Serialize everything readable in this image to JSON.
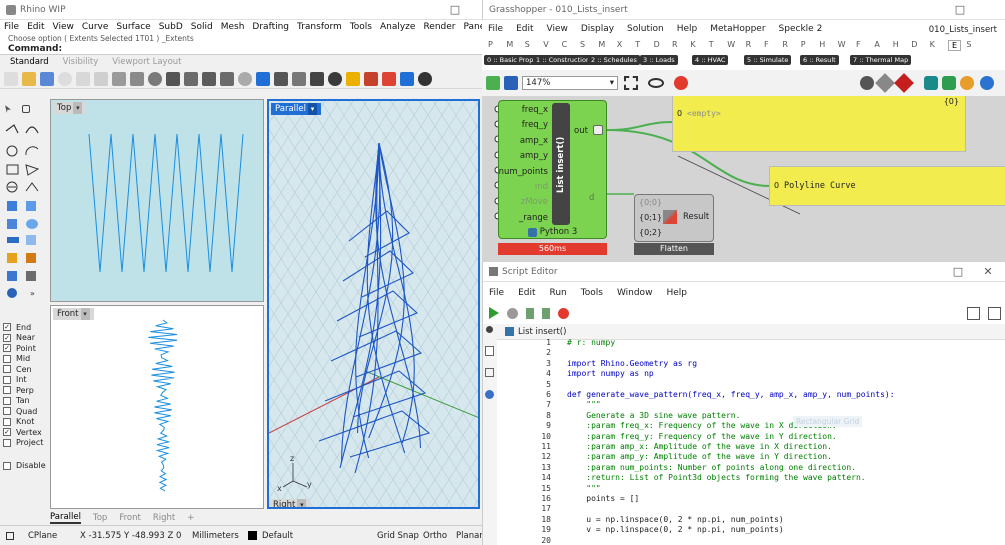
{
  "rhino": {
    "title": "Rhino WIP",
    "menu": [
      "File",
      "Edit",
      "View",
      "Curve",
      "Surface",
      "SubD",
      "Solid",
      "Mesh",
      "Drafting",
      "Transform",
      "Tools",
      "Analyze",
      "Render",
      "Paneling Tools",
      "Window",
      "He"
    ],
    "command_history": "Choose option ( Extents  Selected  1T01 ) _Extents",
    "command_label": "Command:",
    "toolbar_tabs": [
      "Standard",
      "Visibility",
      "Viewport Layout"
    ],
    "viewports": {
      "top": "Top",
      "front": "Front",
      "parallel": "Parallel",
      "right": "Right"
    },
    "osnaps": [
      {
        "label": "End",
        "checked": true
      },
      {
        "label": "Near",
        "checked": true
      },
      {
        "label": "Point",
        "checked": true
      },
      {
        "label": "Mid",
        "checked": false
      },
      {
        "label": "Cen",
        "checked": false
      },
      {
        "label": "Int",
        "checked": false
      },
      {
        "label": "Perp",
        "checked": false
      },
      {
        "label": "Tan",
        "checked": false
      },
      {
        "label": "Quad",
        "checked": false
      },
      {
        "label": "Knot",
        "checked": false
      },
      {
        "label": "Vertex",
        "checked": true
      },
      {
        "label": "Project",
        "checked": false
      }
    ],
    "disable_label": "Disable",
    "bottom_tabs": [
      "Parallel",
      "Top",
      "Front",
      "Right",
      "+"
    ],
    "status": {
      "cplane": "CPlane",
      "coords": "X -31.575  Y -48.993  Z 0",
      "units": "Millimeters",
      "layer": "Default",
      "gridsnap": "Grid Snap",
      "ortho": "Ortho",
      "planar": "Planar"
    }
  },
  "gh": {
    "title": "Grasshopper - 010_Lists_insert",
    "doc_name": "010_Lists_insert",
    "menu": [
      "File",
      "Edit",
      "View",
      "Display",
      "Solution",
      "Help",
      "MetaHopper",
      "Speckle 2"
    ],
    "tabs": [
      "P",
      "M",
      "S",
      "V",
      "C",
      "S",
      "M",
      "X",
      "T",
      "D",
      "R",
      "K",
      "T",
      "W",
      "R",
      "F",
      "R",
      "P",
      "H",
      "W",
      "F",
      "A",
      "H",
      "D",
      "K",
      "E",
      "S"
    ],
    "active_tab": "E",
    "groups": [
      "0 :: Basic Prope...",
      "1 :: Construction...",
      "2 :: Schedules",
      "3 :: Loads",
      "4 :: HVAC",
      "5 :: Simulate",
      "6 :: Result",
      "7 :: Thermal Map"
    ],
    "zoom": "147%",
    "python": {
      "inputs": [
        "freq_x",
        "freq_y",
        "amp_x",
        "amp_y",
        "num_points",
        "ind",
        "zMove",
        "_range"
      ],
      "output_out": "out",
      "output_d": "d",
      "name": "List insert()",
      "footer": "Python 3",
      "time": "560ms"
    },
    "panel1": {
      "count": "{0}",
      "index": "0",
      "text": "<empty>"
    },
    "panel2": {
      "index": "0",
      "text": "Polyline Curve"
    },
    "flatten": {
      "paths": [
        "{0;0}",
        "{0;1}",
        "{0;2}"
      ],
      "result": "Result",
      "name": "Flatten"
    }
  },
  "editor": {
    "title": "Script Editor",
    "menu": [
      "File",
      "Edit",
      "Run",
      "Tools",
      "Window",
      "Help"
    ],
    "tab": "List insert()",
    "ghost": "Rectangular Grid",
    "lines": [
      "# r: numpy",
      "",
      "import Rhino.Geometry as rg",
      "import numpy as np",
      "",
      "def generate_wave_pattern(freq_x, freq_y, amp_x, amp_y, num_points):",
      "    \"\"\"",
      "    Generate a 3D sine wave pattern.",
      "    :param freq_x: Frequency of the wave in X direction.",
      "    :param freq_y: Frequency of the wave in Y direction.",
      "    :param amp_x: Amplitude of the wave in X direction.",
      "    :param amp_y: Amplitude of the wave in Y direction.",
      "    :param num_points: Number of points along one direction.",
      "    :return: List of Point3d objects forming the wave pattern.",
      "    \"\"\"",
      "    points = []",
      "",
      "    u = np.linspace(0, 2 * np.pi, num_points)",
      "    v = np.linspace(0, 2 * np.pi, num_points)",
      ""
    ]
  },
  "colors": {
    "rhino_blue": "#1f6fd6",
    "gh_green": "#7bd34f",
    "panel_yellow": "#f2ec4f",
    "error_red": "#e23a2e"
  }
}
